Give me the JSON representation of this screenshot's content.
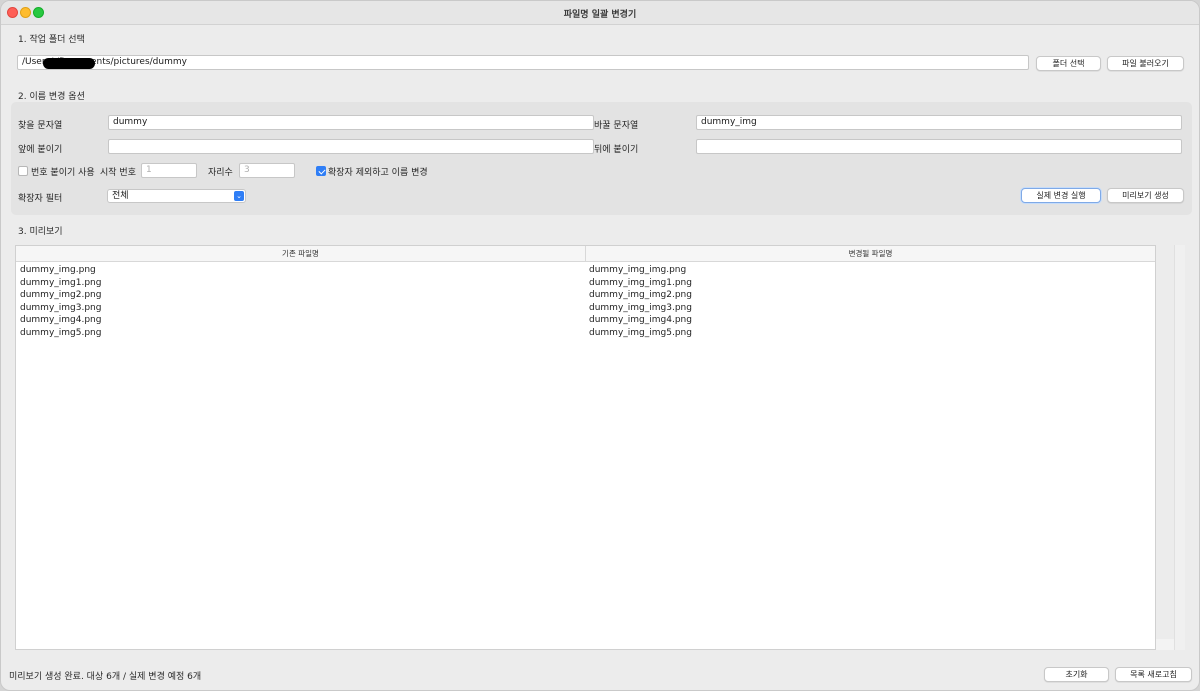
{
  "window": {
    "title": "파일명 일괄 변경기"
  },
  "section1": {
    "label": "1. 작업 폴더 선택",
    "folder_path": "/Users/          /Documents/pictures/dummy",
    "select_folder_button": "폴더 선택",
    "load_files_button": "파일 불러오기"
  },
  "section2": {
    "label": "2. 이름 변경 옵션",
    "find_label": "찾을 문자열",
    "find_value": "dummy",
    "replace_label": "바꿀 문자열",
    "replace_value": "dummy_img",
    "prefix_label": "앞에 붙이기",
    "prefix_value": "",
    "suffix_label": "뒤에 붙이기",
    "suffix_value": "",
    "numbering_label": "번호 붙이기 사용",
    "numbering_checked": false,
    "start_number_label": "시작 번호",
    "start_number_value": "1",
    "digits_label": "자리수",
    "digits_value": "3",
    "exclude_ext_label": "확장자 제외하고 이름 변경",
    "exclude_ext_checked": true,
    "ext_filter_label": "확장자 필터",
    "ext_filter_value": "전체",
    "execute_button": "실제 변경 실행",
    "preview_button": "미리보기 생성"
  },
  "section3": {
    "label": "3. 미리보기",
    "columns": [
      "기존 파일명",
      "변경될 파일명"
    ],
    "rows": [
      [
        "dummy_img.png",
        "dummy_img_img.png"
      ],
      [
        "dummy_img1.png",
        "dummy_img_img1.png"
      ],
      [
        "dummy_img2.png",
        "dummy_img_img2.png"
      ],
      [
        "dummy_img3.png",
        "dummy_img_img3.png"
      ],
      [
        "dummy_img4.png",
        "dummy_img_img4.png"
      ],
      [
        "dummy_img5.png",
        "dummy_img_img5.png"
      ]
    ]
  },
  "footer": {
    "status_text": "미리보기 생성 완료. 대상 6개 / 실제 변경 예정 6개",
    "reset_button": "초기화",
    "refresh_button": "목록 새로고침"
  },
  "colors": {
    "accent": "#2f7ef6",
    "window_bg": "#ececec",
    "group_bg": "#e3e3e3"
  }
}
